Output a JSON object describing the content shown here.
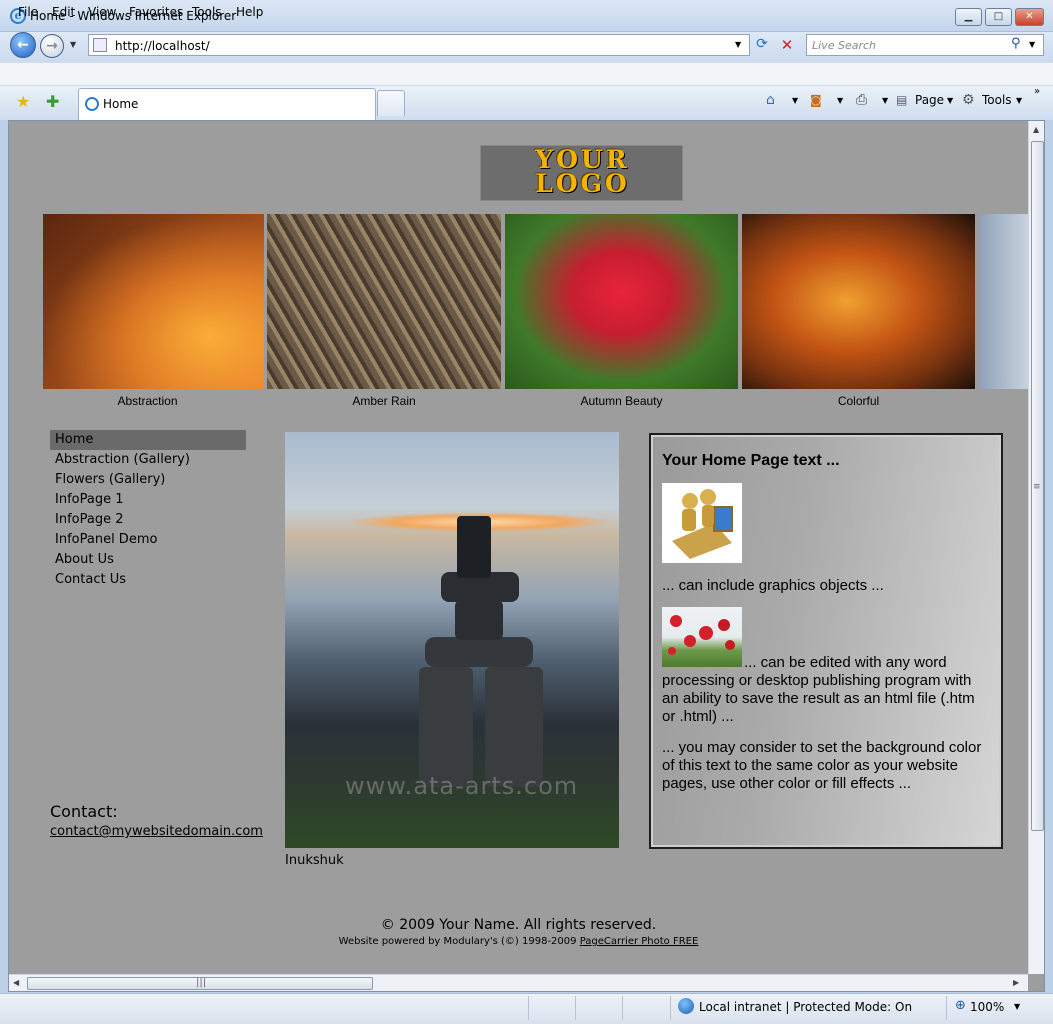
{
  "window": {
    "title": "Home - Windows Internet Explorer",
    "min": "▁",
    "max": "□",
    "close": "✕"
  },
  "address": {
    "url": "http://localhost/",
    "search_placeholder": "Live Search"
  },
  "menu": [
    "File",
    "Edit",
    "View",
    "Favorites",
    "Tools",
    "Help"
  ],
  "tab": {
    "label": "Home"
  },
  "commandbar": {
    "page": "Page",
    "tools": "Tools"
  },
  "page": {
    "logo": {
      "line1": "YOUR",
      "line2": "LOGO"
    },
    "gallery": [
      {
        "caption": "Abstraction"
      },
      {
        "caption": "Amber Rain"
      },
      {
        "caption": "Autumn Beauty"
      },
      {
        "caption": "Colorful"
      }
    ],
    "nav": [
      {
        "label": "Home",
        "active": true
      },
      {
        "label": "Abstraction (Gallery)"
      },
      {
        "label": "Flowers (Gallery)"
      },
      {
        "label": "InfoPage 1"
      },
      {
        "label": "InfoPage 2"
      },
      {
        "label": "InfoPanel Demo"
      },
      {
        "label": "About Us"
      },
      {
        "label": "Contact Us"
      }
    ],
    "contact": {
      "label": "Contact:",
      "email": "contact@mywebsitedomain.com"
    },
    "main_photo": {
      "caption": "Inukshuk",
      "watermark": "www.ata-arts.com"
    },
    "panel": {
      "title": "Your Home Page text ...",
      "p1": "... can include graphics objects ...",
      "p2": "... can be edited with any word processing or desktop publishing program with an ability to save the result as an html file (.htm or .html)  ...",
      "p3": "... you may consider to set the background color of this text to the same color as your website pages, use other color or fill effects  ..."
    },
    "footer": {
      "copyright": "© 2009 Your Name. All rights reserved.",
      "powered_prefix": "Website powered by Modulary's (©) 1998-2009 ",
      "powered_link": "PageCarrier Photo FREE"
    }
  },
  "status": {
    "zone": "Local intranet | Protected Mode: On",
    "zoom": "100%"
  }
}
